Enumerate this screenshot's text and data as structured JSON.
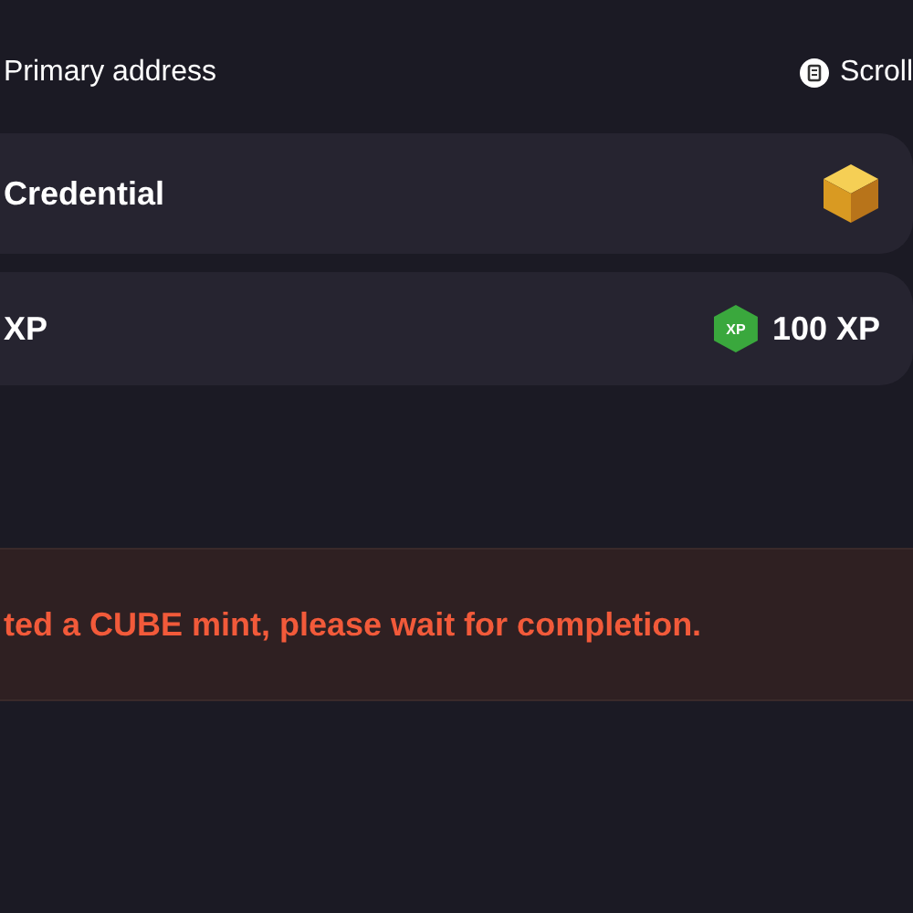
{
  "header": {
    "label": "Primary address",
    "scroll_label": "Scroll"
  },
  "rows": [
    {
      "kind": "cube",
      "label": "Credential"
    },
    {
      "kind": "xp",
      "label": "XP",
      "badge": "XP",
      "value": "100 XP"
    }
  ],
  "notice": {
    "text": "ted a CUBE mint, please wait for completion."
  }
}
